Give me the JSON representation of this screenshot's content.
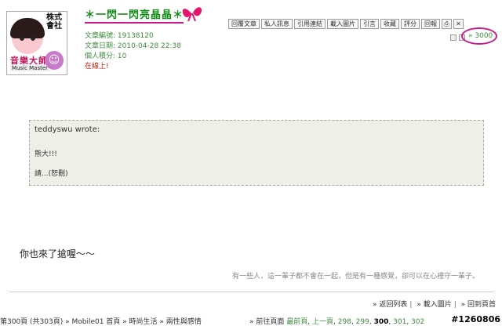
{
  "user": {
    "name": "＊一閃一閃亮晶晶＊",
    "avatar_stamp": "株式會社",
    "avatar_band": "音樂大師",
    "avatar_sub": "Music Master"
  },
  "meta": {
    "article_no": "文章編號: 19138120",
    "article_date": "文章日期: 2010-04-28 22:38",
    "points": "個人積分: 10",
    "online": "在線上!"
  },
  "toolbar": [
    "回覆文章",
    "私人訊息",
    "引用連結",
    "載入圖片",
    "引言",
    "收藏",
    "評分",
    "回報"
  ],
  "post_number": "» 3000",
  "quote": {
    "author": "teddyswu wrote:",
    "line1": "熊大!!!",
    "line2": "請...(恕刪)"
  },
  "body": "你也來了搶喔～～",
  "signature": "有一些人，這一輩子都不會在一起，但是有一種感覺，卻可以在心裡守一輩子。",
  "footer_links": [
    "» 返回列表",
    "» 載入圖片",
    "» 回到頁首"
  ],
  "breadcrumbs": "第300頁 (共303頁) » Mobile01 首頁 » 時尚生活 » 兩性與感情",
  "pager": {
    "label": "» 前往頁面",
    "first": "最前頁",
    "prev": "上一頁",
    "pages": [
      "298",
      "299",
      "300",
      "301",
      "302"
    ],
    "current": "300"
  },
  "watermark": "#1260806"
}
